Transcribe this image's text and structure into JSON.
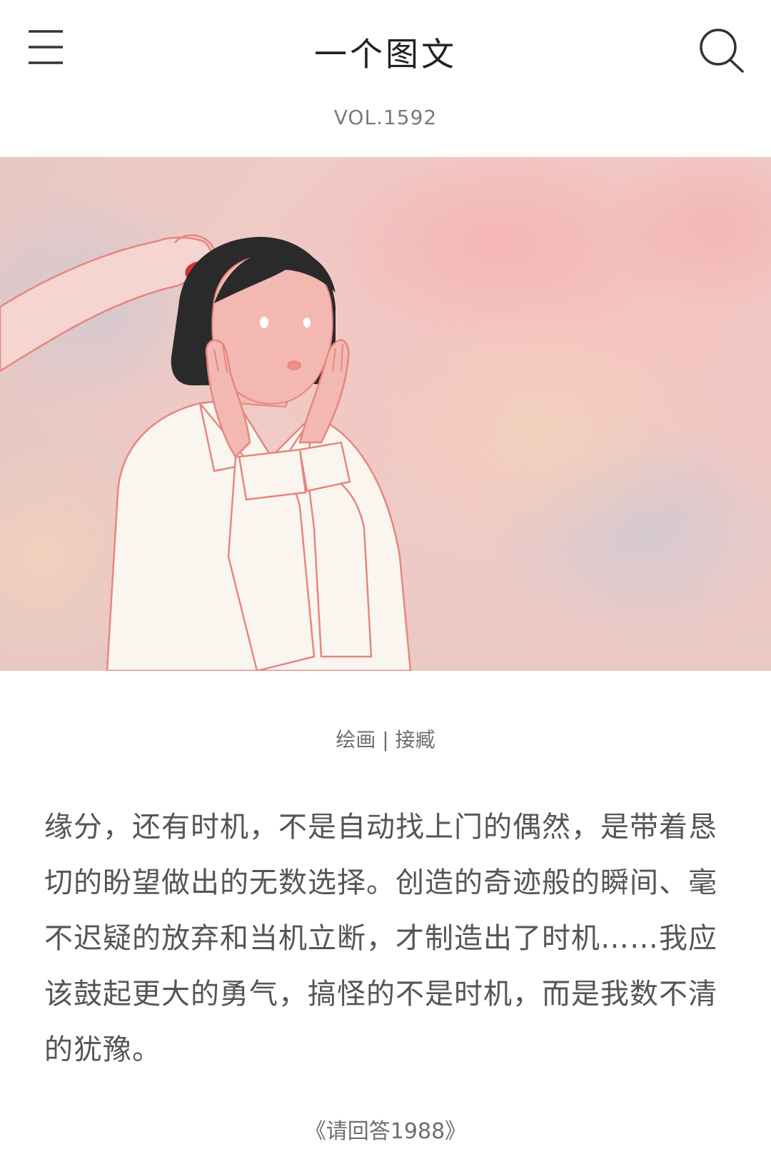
{
  "header": {
    "title": "一个图文",
    "menu_icon": "hamburger-menu-icon",
    "search_icon": "search-icon"
  },
  "article": {
    "volume": "VOL.1592",
    "image_subject": "illustration of a girl with short black hair, hands on cheeks, an arm cutting her hair with red scissors, pink watercolor background",
    "credit": "绘画 | 接臧",
    "quote": "缘分，还有时机，不是自动找上门的偶然，是带着恳切的盼望做出的无数选择。创造的奇迹般的瞬间、毫不迟疑的放弃和当机立断，才制造出了时机……我应该鼓起更大的勇气，搞怪的不是时机，而是我数不清的犹豫。",
    "source": "《请回答1988》"
  },
  "colors": {
    "background": "#ffffff",
    "title": "#222222",
    "secondary_text": "#7a7a7a",
    "body_text": "#555555",
    "illustration_bg": "#f1c9c6"
  }
}
